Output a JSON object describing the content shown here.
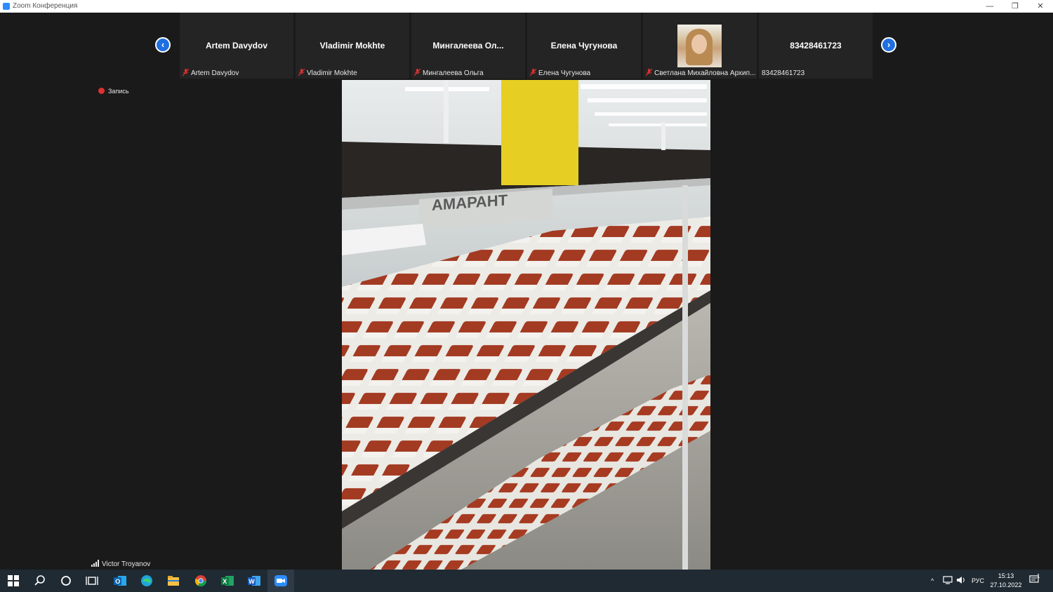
{
  "window": {
    "title": "Zoom Конференция",
    "controls": {
      "minimize": "—",
      "maximize": "❐",
      "close": "✕"
    }
  },
  "participants_strip": {
    "prev_label": "‹",
    "next_label": "›",
    "tiles": [
      {
        "name": "Artem Davydov",
        "label": "Artem Davydov",
        "muted": true
      },
      {
        "name": "Vladimir Mokhte",
        "label": "Vladimir Mokhte",
        "muted": true
      },
      {
        "name": "Мингалеева  Ол...",
        "label": "Мингалеева Ольга",
        "muted": true
      },
      {
        "name": "Елена Чугунова",
        "label": "Елена Чугунова",
        "muted": true
      },
      {
        "name": "",
        "label": "Светлана Михайловна Архип...",
        "muted": true,
        "has_photo": true
      },
      {
        "name": "83428461723",
        "label": "83428461723",
        "muted": false
      }
    ]
  },
  "recording": {
    "label": "Запись"
  },
  "active_speaker": {
    "name": "Victor Troyanov"
  },
  "video": {
    "sign_text": "АМАРАНТ"
  },
  "taskbar": {
    "apps": [
      "windows-start",
      "search",
      "cortana",
      "task-view",
      "outlook",
      "edge",
      "file-explorer",
      "chrome",
      "excel",
      "word",
      "zoom"
    ],
    "tray_language": "РУС",
    "time": "15:13",
    "date": "27.10.2022",
    "notification_count": "1"
  },
  "colors": {
    "zoom_blue": "#2d8cff",
    "nav_blue": "#1f6fe0",
    "background": "#1a1a1a",
    "tile": "#242424",
    "mute_red": "#e0302f"
  }
}
